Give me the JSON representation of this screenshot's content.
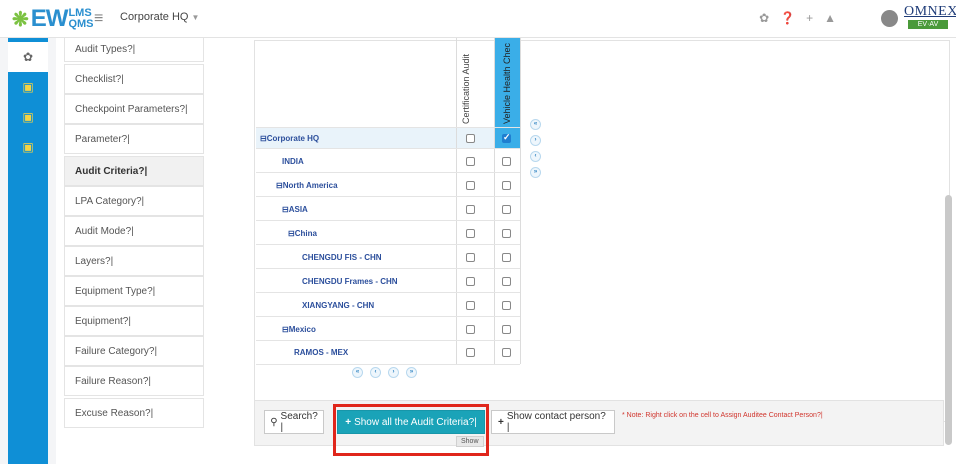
{
  "header": {
    "logo_main": "EW",
    "logo_top": "LMS",
    "logo_bottom": "QMS",
    "site": "Corporate HQ",
    "brand": "OMNEX",
    "brand_sub": "EV·AV"
  },
  "menu": {
    "items": [
      {
        "label": "Audit Types?|",
        "active": false
      },
      {
        "label": "Checklist?|",
        "active": false
      },
      {
        "label": "Checkpoint Parameters?|",
        "active": false
      },
      {
        "label": "Parameter?|",
        "active": false
      },
      {
        "label": "Audit Criteria?|",
        "active": true
      },
      {
        "label": "LPA Category?|",
        "active": false
      },
      {
        "label": "Audit Mode?|",
        "active": false
      },
      {
        "label": "Layers?|",
        "active": false
      },
      {
        "label": "Equipment Type?|",
        "active": false
      },
      {
        "label": "Equipment?|",
        "active": false
      },
      {
        "label": "Failure Category?|",
        "active": false
      },
      {
        "label": "Failure Reason?|",
        "active": false
      },
      {
        "label": "Excuse Reason?|",
        "active": false
      }
    ]
  },
  "grid": {
    "columns": [
      "Certification Audit",
      "Vehicle Health Chec"
    ],
    "rows": [
      {
        "label": "⊟Corporate HQ",
        "checks": [
          false,
          true
        ]
      },
      {
        "label": "INDIA",
        "checks": [
          false,
          false
        ]
      },
      {
        "label": "⊟North America",
        "checks": [
          false,
          false
        ]
      },
      {
        "label": "⊟ASIA",
        "checks": [
          false,
          false
        ]
      },
      {
        "label": "⊟China",
        "checks": [
          false,
          false
        ]
      },
      {
        "label": "CHENGDU FIS - CHN",
        "checks": [
          false,
          false
        ]
      },
      {
        "label": "CHENGDU Frames - CHN",
        "checks": [
          false,
          false
        ]
      },
      {
        "label": "XIANGYANG - CHN",
        "checks": [
          false,
          false
        ]
      },
      {
        "label": "⊟Mexico",
        "checks": [
          false,
          false
        ]
      },
      {
        "label": "RAMOS - MEX",
        "checks": [
          false,
          false
        ]
      }
    ],
    "pager": [
      "«",
      "‹",
      "›",
      "»"
    ],
    "row_nav": [
      "«",
      "‹",
      "›",
      "»"
    ]
  },
  "toolbar": {
    "search": "Search?|",
    "show_all": "Show all the Audit Criteria?|",
    "show_tooltip": "Show",
    "show_contact": "Show contact person?|",
    "note": "* Note: Right click on the cell to Assign Auditee Contact Person?|"
  },
  "colors": {
    "rail": "#0f8fd6",
    "primary_button": "#1aa3b8",
    "highlight_outline": "#e0261b",
    "tree_text": "#2c4f9c"
  }
}
